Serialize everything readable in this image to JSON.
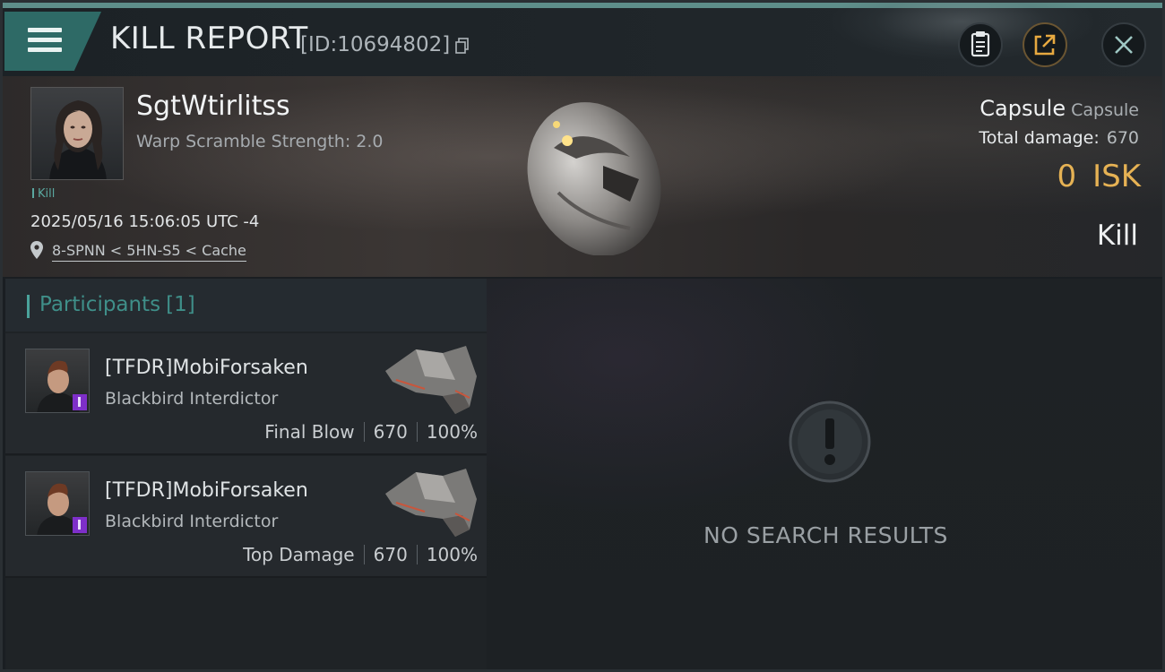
{
  "header": {
    "title": "KILL REPORT",
    "report_id": "[ID:10694802]"
  },
  "victim": {
    "pilot_name": "SgtWtirlitss",
    "warp_scramble": "Warp Scramble Strength: 2.0",
    "kill_tag": "Kill",
    "timestamp": "2025/05/16 15:06:05 UTC -4",
    "location": "8-SPNN < 5HN-S5 < Cache"
  },
  "summary": {
    "ship_name": "Capsule",
    "ship_type": "Capsule",
    "total_damage_label": "Total damage:",
    "total_damage_value": "670",
    "isk_value": "0",
    "isk_unit": "ISK",
    "result": "Kill"
  },
  "participants": {
    "title": "Participants",
    "count": "[1]",
    "rows": [
      {
        "name": "[TFDR]MobiForsaken",
        "ship": "Blackbird Interdictor",
        "role": "Final Blow",
        "damage": "670",
        "percent": "100%"
      },
      {
        "name": "[TFDR]MobiForsaken",
        "ship": "Blackbird Interdictor",
        "role": "Top Damage",
        "damage": "670",
        "percent": "100%"
      }
    ]
  },
  "results_panel": {
    "message": "NO SEARCH RESULTS",
    "icon": "exclamation-icon"
  },
  "icons": {
    "menu": "hamburger-menu-icon",
    "copy": "copy-icon",
    "clipboard": "clipboard-icon",
    "share": "share-icon",
    "close": "close-icon",
    "location": "location-pin-icon"
  },
  "colors": {
    "accent_teal": "#2e6a66",
    "participants_title": "#3f8f89",
    "isk_gold": "#e6b254",
    "pilot_badge_purple": "#7e2fc9"
  }
}
